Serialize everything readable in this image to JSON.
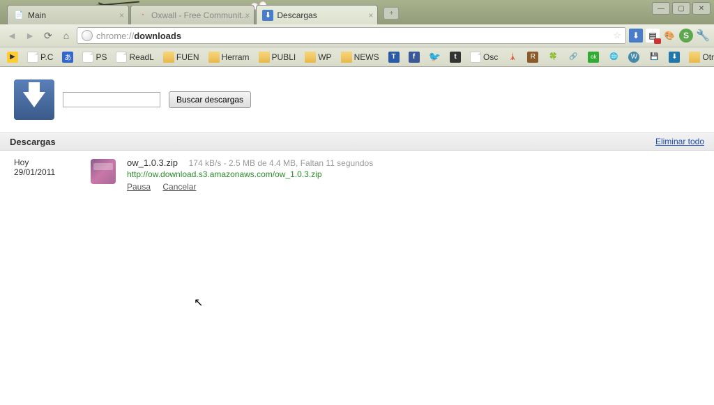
{
  "tabs": [
    {
      "favicon": "🌐",
      "title": "Main"
    },
    {
      "favicon": "◔",
      "title": "Oxwall - Free Communit..."
    },
    {
      "favicon": "⬇",
      "title": "Descargas"
    }
  ],
  "url_proto": "chrome://",
  "url_path": "downloads",
  "bookmarks": {
    "items": [
      "P.C",
      "PS",
      "ReadL",
      "FUEN",
      "Herram",
      "PUBLI",
      "WP",
      "NEWS",
      "Osc"
    ],
    "other": "Otros marcadores"
  },
  "search": {
    "button": "Buscar descargas"
  },
  "section": {
    "title": "Descargas",
    "clear": "Eliminar todo"
  },
  "date": {
    "label": "Hoy",
    "value": "29/01/2011"
  },
  "download": {
    "filename": "ow_1.0.3.zip",
    "status": "174 kB/s - 2.5 MB de 4.4 MB, Faltan 11 segundos",
    "url": "http://ow.download.s3.amazonaws.com/ow_1.0.3.zip",
    "pause": "Pausa",
    "cancel": "Cancelar"
  }
}
